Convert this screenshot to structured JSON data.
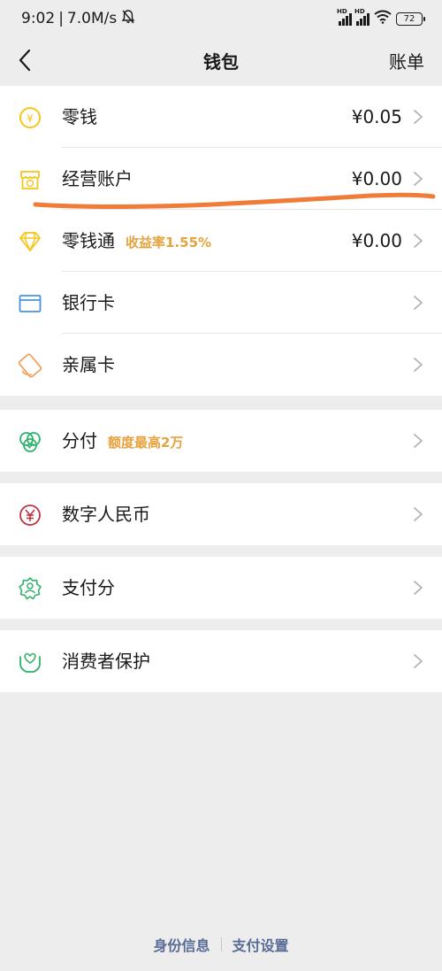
{
  "status": {
    "time": "9:02",
    "speed": "7.0M/s",
    "signal1_label": "HD",
    "signal2_label": "HD",
    "battery": "72"
  },
  "nav": {
    "title": "钱包",
    "right": "账单"
  },
  "groups": [
    {
      "items": [
        {
          "label": "零钱",
          "value": "¥0.05",
          "icon": "coin-icon",
          "color": "#f5c518"
        },
        {
          "label": "经营账户",
          "value": "¥0.00",
          "icon": "shop-icon",
          "color": "#f5c518"
        },
        {
          "label": "零钱通",
          "tag": "收益率1.55%",
          "value": "¥0.00",
          "icon": "diamond-icon",
          "color": "#f5c518"
        },
        {
          "label": "银行卡",
          "icon": "bank-card-icon",
          "color": "#4a90e2"
        },
        {
          "label": "亲属卡",
          "icon": "family-card-icon",
          "color": "#f0a460"
        }
      ]
    },
    {
      "items": [
        {
          "label": "分付",
          "tag": "额度最高2万",
          "icon": "installment-icon",
          "color": "#2fb36a"
        }
      ]
    },
    {
      "items": [
        {
          "label": "数字人民币",
          "icon": "digital-rmb-icon",
          "color": "#b8343f"
        }
      ]
    },
    {
      "items": [
        {
          "label": "支付分",
          "icon": "pay-score-icon",
          "color": "#2fb36a"
        }
      ]
    },
    {
      "items": [
        {
          "label": "消费者保护",
          "icon": "consumer-protection-icon",
          "color": "#2fb36a"
        }
      ]
    }
  ],
  "footer": {
    "identity": "身份信息",
    "settings": "支付设置"
  },
  "colors": {
    "annotation": "#f07c3a",
    "tag": "#e6a23c",
    "link": "#576b95"
  }
}
